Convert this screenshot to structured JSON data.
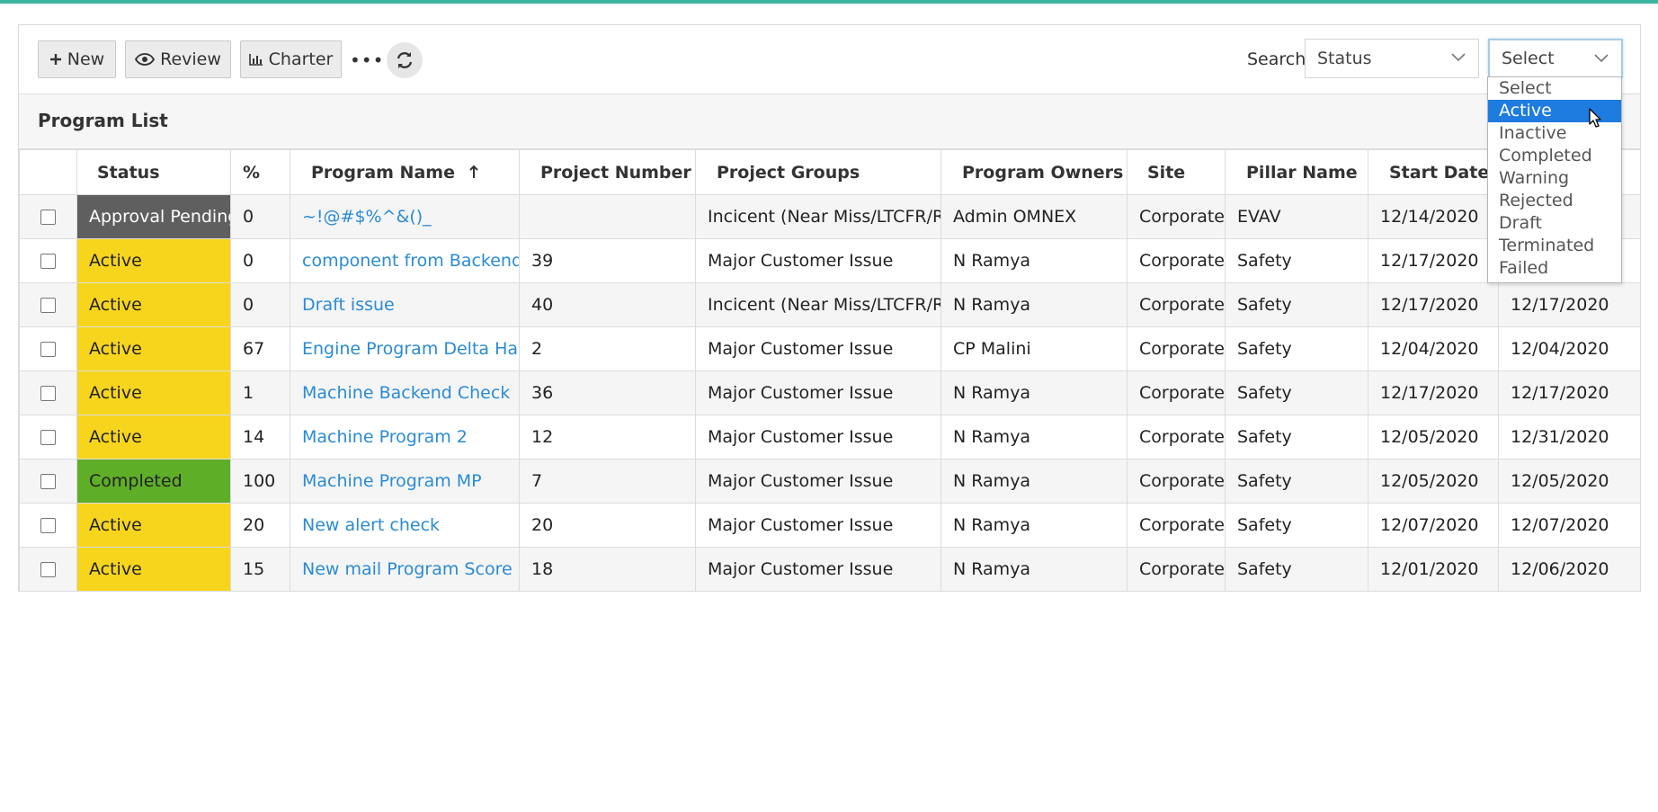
{
  "toolbar": {
    "new_label": "New",
    "review_label": "Review",
    "charter_label": "Charter",
    "more_label": "•••",
    "search_label": "Search",
    "field_select_value": "Status",
    "value_select_value": "Select"
  },
  "list_title": "Program List",
  "columns": [
    "Status",
    "%",
    "Program Name",
    "Project Number",
    "Project Groups",
    "Program Owners",
    "Site",
    "Pillar Name",
    "Start Date",
    ""
  ],
  "rows": [
    {
      "status": "Approval Pending",
      "status_color": "#5f5f5f",
      "percent": "0",
      "name": "~!@#$%^&()_",
      "number": "",
      "group": "Incicent (Near Miss/LTCFR/RIF)",
      "owner": "Admin OMNEX",
      "site": "Corporate",
      "pillar": "EVAV",
      "start": "12/14/2020",
      "end": ""
    },
    {
      "status": "Active",
      "status_color": "#f7d51d",
      "percent": "0",
      "name": "component from Backend",
      "number": "39",
      "group": "Major Customer Issue",
      "owner": "N Ramya",
      "site": "Corporate",
      "pillar": "Safety",
      "start": "12/17/2020",
      "end": ""
    },
    {
      "status": "Active",
      "status_color": "#f7d51d",
      "percent": "0",
      "name": "Draft issue",
      "number": "40",
      "group": "Incicent (Near Miss/LTCFR/RIF)",
      "owner": "N Ramya",
      "site": "Corporate",
      "pillar": "Safety",
      "start": "12/17/2020",
      "end": "12/17/2020"
    },
    {
      "status": "Active",
      "status_color": "#f7d51d",
      "percent": "67",
      "name": "Engine Program Delta Hawk",
      "number": "2",
      "group": "Major Customer Issue",
      "owner": "CP Malini",
      "site": "Corporate",
      "pillar": "Safety",
      "start": "12/04/2020",
      "end": "12/04/2020"
    },
    {
      "status": "Active",
      "status_color": "#f7d51d",
      "percent": "1",
      "name": "Machine Backend Check",
      "number": "36",
      "group": "Major Customer Issue",
      "owner": "N Ramya",
      "site": "Corporate",
      "pillar": "Safety",
      "start": "12/17/2020",
      "end": "12/17/2020"
    },
    {
      "status": "Active",
      "status_color": "#f7d51d",
      "percent": "14",
      "name": "Machine Program 2",
      "number": "12",
      "group": "Major Customer Issue",
      "owner": "N Ramya",
      "site": "Corporate",
      "pillar": "Safety",
      "start": "12/05/2020",
      "end": "12/31/2020"
    },
    {
      "status": "Completed",
      "status_color": "#5fae28",
      "percent": "100",
      "name": "Machine Program MP",
      "number": "7",
      "group": "Major Customer Issue",
      "owner": "N Ramya",
      "site": "Corporate",
      "pillar": "Safety",
      "start": "12/05/2020",
      "end": "12/05/2020"
    },
    {
      "status": "Active",
      "status_color": "#f7d51d",
      "percent": "20",
      "name": "New alert check",
      "number": "20",
      "group": "Major Customer Issue",
      "owner": "N Ramya",
      "site": "Corporate",
      "pillar": "Safety",
      "start": "12/07/2020",
      "end": "12/07/2020"
    },
    {
      "status": "Active",
      "status_color": "#f7d51d",
      "percent": "15",
      "name": "New mail Program Score",
      "number": "18",
      "group": "Major Customer Issue",
      "owner": "N Ramya",
      "site": "Corporate",
      "pillar": "Safety",
      "start": "12/01/2020",
      "end": "12/06/2020"
    }
  ],
  "dropdown_options": [
    "Select",
    "Active",
    "Inactive",
    "Completed",
    "Warning",
    "Rejected",
    "Draft",
    "Terminated",
    "Failed"
  ],
  "dropdown_selected_index": 1,
  "colors": {
    "accent": "#3bb5a2",
    "link": "#2a8bd6",
    "highlight": "#1e7be0"
  }
}
